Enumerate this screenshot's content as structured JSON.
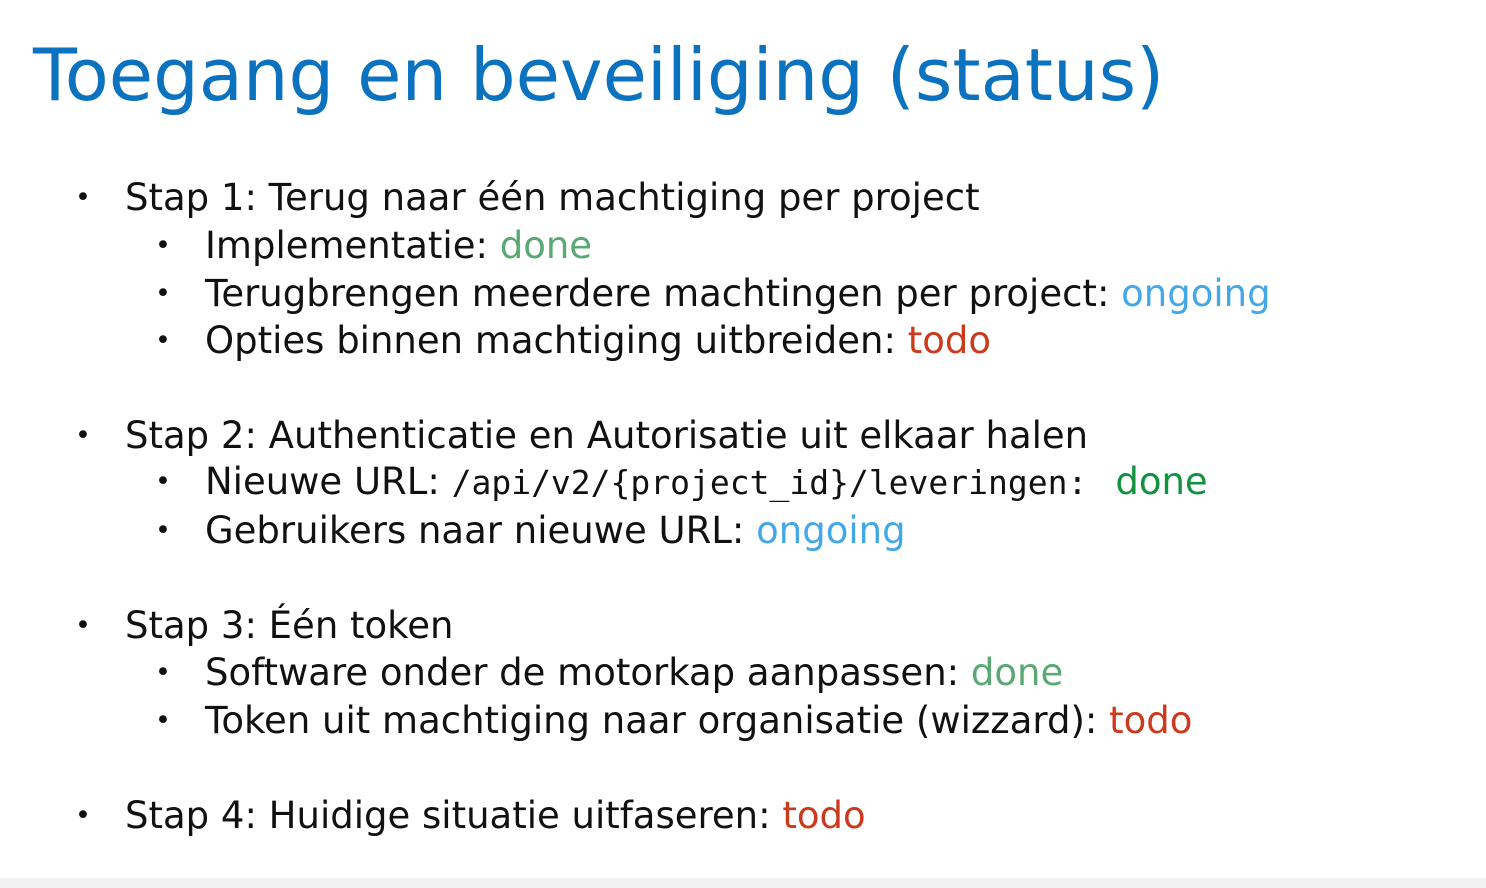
{
  "title": "Toegang en beveiliging (status)",
  "bullet_char": "•",
  "colors": {
    "title": "#0b72c0",
    "done": "#5aa873",
    "done_alt": "#12923f",
    "ongoing": "#45a8e6",
    "todo": "#cc3a1e"
  },
  "steps": [
    {
      "label": "Stap 1: Terug naar één machtiging per project",
      "items": [
        {
          "text": "Implementatie: ",
          "status": "done"
        },
        {
          "text": "Terugbrengen meerdere machtingen per project: ",
          "status": "ongoing"
        },
        {
          "text": "Opties binnen machtiging uitbreiden: ",
          "status": "todo"
        }
      ]
    },
    {
      "label": "Stap 2: Authenticatie en Autorisatie uit elkaar halen",
      "items": [
        {
          "text": "Nieuwe URL: ",
          "code": "/api/v2/{project_id}/leveringen:",
          "status": "done"
        },
        {
          "text": "Gebruikers naar nieuwe URL: ",
          "status": "ongoing"
        }
      ]
    },
    {
      "label": "Stap 3: Één token",
      "items": [
        {
          "text": "Software onder de motorkap aanpassen: ",
          "status": "done"
        },
        {
          "text": "Token uit machtiging naar organisatie (wizzard): ",
          "status": "todo"
        }
      ]
    },
    {
      "label": "Stap 4: Huidige situatie uitfaseren: ",
      "status": "todo"
    }
  ]
}
